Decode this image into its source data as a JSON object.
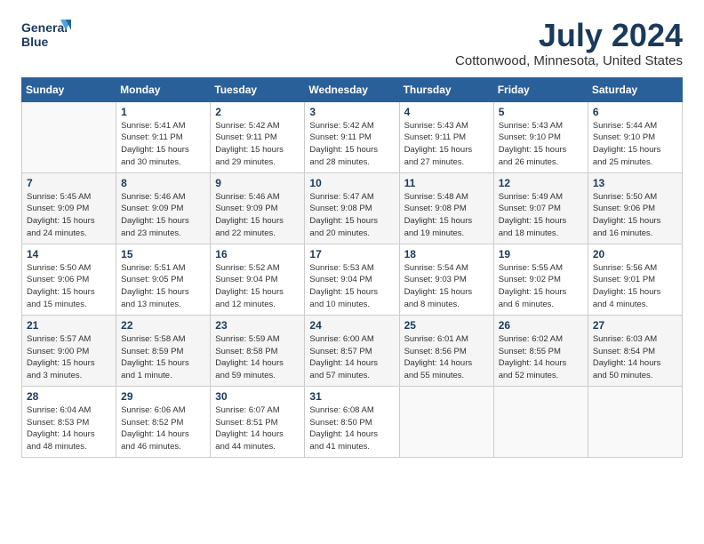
{
  "logo": {
    "line1": "General",
    "line2": "Blue"
  },
  "title": "July 2024",
  "location": "Cottonwood, Minnesota, United States",
  "weekdays": [
    "Sunday",
    "Monday",
    "Tuesday",
    "Wednesday",
    "Thursday",
    "Friday",
    "Saturday"
  ],
  "weeks": [
    [
      {
        "day": "",
        "info": ""
      },
      {
        "day": "1",
        "info": "Sunrise: 5:41 AM\nSunset: 9:11 PM\nDaylight: 15 hours\nand 30 minutes."
      },
      {
        "day": "2",
        "info": "Sunrise: 5:42 AM\nSunset: 9:11 PM\nDaylight: 15 hours\nand 29 minutes."
      },
      {
        "day": "3",
        "info": "Sunrise: 5:42 AM\nSunset: 9:11 PM\nDaylight: 15 hours\nand 28 minutes."
      },
      {
        "day": "4",
        "info": "Sunrise: 5:43 AM\nSunset: 9:11 PM\nDaylight: 15 hours\nand 27 minutes."
      },
      {
        "day": "5",
        "info": "Sunrise: 5:43 AM\nSunset: 9:10 PM\nDaylight: 15 hours\nand 26 minutes."
      },
      {
        "day": "6",
        "info": "Sunrise: 5:44 AM\nSunset: 9:10 PM\nDaylight: 15 hours\nand 25 minutes."
      }
    ],
    [
      {
        "day": "7",
        "info": "Sunrise: 5:45 AM\nSunset: 9:09 PM\nDaylight: 15 hours\nand 24 minutes."
      },
      {
        "day": "8",
        "info": "Sunrise: 5:46 AM\nSunset: 9:09 PM\nDaylight: 15 hours\nand 23 minutes."
      },
      {
        "day": "9",
        "info": "Sunrise: 5:46 AM\nSunset: 9:09 PM\nDaylight: 15 hours\nand 22 minutes."
      },
      {
        "day": "10",
        "info": "Sunrise: 5:47 AM\nSunset: 9:08 PM\nDaylight: 15 hours\nand 20 minutes."
      },
      {
        "day": "11",
        "info": "Sunrise: 5:48 AM\nSunset: 9:08 PM\nDaylight: 15 hours\nand 19 minutes."
      },
      {
        "day": "12",
        "info": "Sunrise: 5:49 AM\nSunset: 9:07 PM\nDaylight: 15 hours\nand 18 minutes."
      },
      {
        "day": "13",
        "info": "Sunrise: 5:50 AM\nSunset: 9:06 PM\nDaylight: 15 hours\nand 16 minutes."
      }
    ],
    [
      {
        "day": "14",
        "info": "Sunrise: 5:50 AM\nSunset: 9:06 PM\nDaylight: 15 hours\nand 15 minutes."
      },
      {
        "day": "15",
        "info": "Sunrise: 5:51 AM\nSunset: 9:05 PM\nDaylight: 15 hours\nand 13 minutes."
      },
      {
        "day": "16",
        "info": "Sunrise: 5:52 AM\nSunset: 9:04 PM\nDaylight: 15 hours\nand 12 minutes."
      },
      {
        "day": "17",
        "info": "Sunrise: 5:53 AM\nSunset: 9:04 PM\nDaylight: 15 hours\nand 10 minutes."
      },
      {
        "day": "18",
        "info": "Sunrise: 5:54 AM\nSunset: 9:03 PM\nDaylight: 15 hours\nand 8 minutes."
      },
      {
        "day": "19",
        "info": "Sunrise: 5:55 AM\nSunset: 9:02 PM\nDaylight: 15 hours\nand 6 minutes."
      },
      {
        "day": "20",
        "info": "Sunrise: 5:56 AM\nSunset: 9:01 PM\nDaylight: 15 hours\nand 4 minutes."
      }
    ],
    [
      {
        "day": "21",
        "info": "Sunrise: 5:57 AM\nSunset: 9:00 PM\nDaylight: 15 hours\nand 3 minutes."
      },
      {
        "day": "22",
        "info": "Sunrise: 5:58 AM\nSunset: 8:59 PM\nDaylight: 15 hours\nand 1 minute."
      },
      {
        "day": "23",
        "info": "Sunrise: 5:59 AM\nSunset: 8:58 PM\nDaylight: 14 hours\nand 59 minutes."
      },
      {
        "day": "24",
        "info": "Sunrise: 6:00 AM\nSunset: 8:57 PM\nDaylight: 14 hours\nand 57 minutes."
      },
      {
        "day": "25",
        "info": "Sunrise: 6:01 AM\nSunset: 8:56 PM\nDaylight: 14 hours\nand 55 minutes."
      },
      {
        "day": "26",
        "info": "Sunrise: 6:02 AM\nSunset: 8:55 PM\nDaylight: 14 hours\nand 52 minutes."
      },
      {
        "day": "27",
        "info": "Sunrise: 6:03 AM\nSunset: 8:54 PM\nDaylight: 14 hours\nand 50 minutes."
      }
    ],
    [
      {
        "day": "28",
        "info": "Sunrise: 6:04 AM\nSunset: 8:53 PM\nDaylight: 14 hours\nand 48 minutes."
      },
      {
        "day": "29",
        "info": "Sunrise: 6:06 AM\nSunset: 8:52 PM\nDaylight: 14 hours\nand 46 minutes."
      },
      {
        "day": "30",
        "info": "Sunrise: 6:07 AM\nSunset: 8:51 PM\nDaylight: 14 hours\nand 44 minutes."
      },
      {
        "day": "31",
        "info": "Sunrise: 6:08 AM\nSunset: 8:50 PM\nDaylight: 14 hours\nand 41 minutes."
      },
      {
        "day": "",
        "info": ""
      },
      {
        "day": "",
        "info": ""
      },
      {
        "day": "",
        "info": ""
      }
    ]
  ]
}
